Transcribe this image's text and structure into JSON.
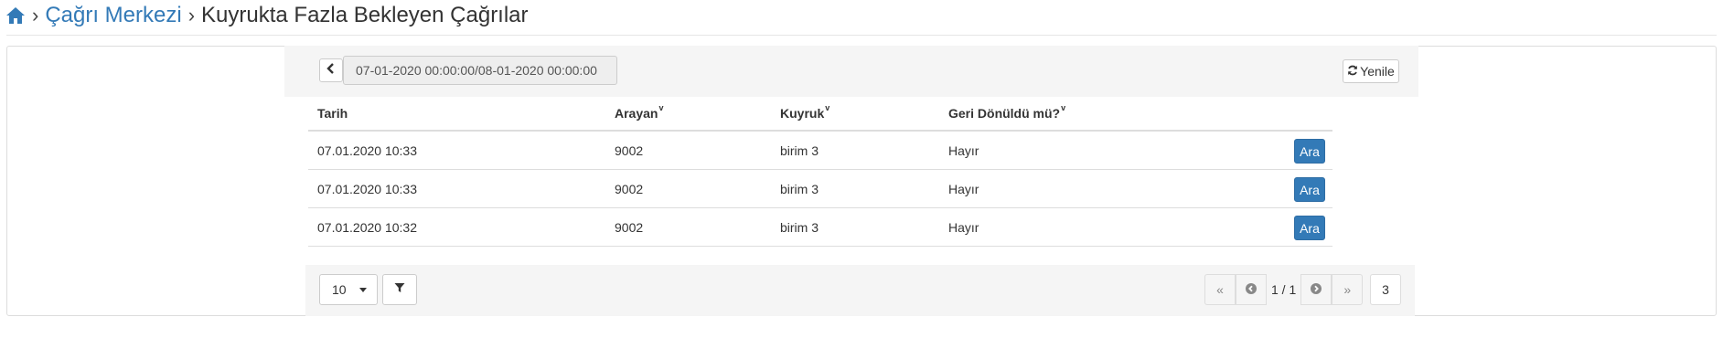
{
  "breadcrumb": {
    "home_icon": "home-icon",
    "section": "Çağrı Merkezi",
    "title": "Kuyrukta Fazla Bekleyen Çağrılar"
  },
  "toolbar": {
    "date_range": "07-01-2020 00:00:00/08-01-2020 00:00:00",
    "refresh_label": "Yenile",
    "refresh_icon": "refresh-icon",
    "prev_icon": "chevron-left-icon"
  },
  "table": {
    "columns": [
      "Tarih",
      "Arayan",
      "Kuyruk",
      "Geri Dönüldü mü?"
    ],
    "sort_caret": "v",
    "rows": [
      {
        "tarih": "07.01.2020 10:33",
        "arayan": "9002",
        "kuyruk": "birim 3",
        "geri_donuldu": "Hayır",
        "action": "Ara"
      },
      {
        "tarih": "07.01.2020 10:33",
        "arayan": "9002",
        "kuyruk": "birim 3",
        "geri_donuldu": "Hayır",
        "action": "Ara"
      },
      {
        "tarih": "07.01.2020 10:32",
        "arayan": "9002",
        "kuyruk": "birim 3",
        "geri_donuldu": "Hayır",
        "action": "Ara"
      }
    ]
  },
  "footer": {
    "page_size": "10",
    "pager": {
      "first": "«",
      "last": "»",
      "info": "1 / 1"
    },
    "total_count": "3"
  },
  "colors": {
    "link": "#337ab7",
    "primary_button": "#337ab7",
    "panel_bg": "#f5f5f5"
  }
}
